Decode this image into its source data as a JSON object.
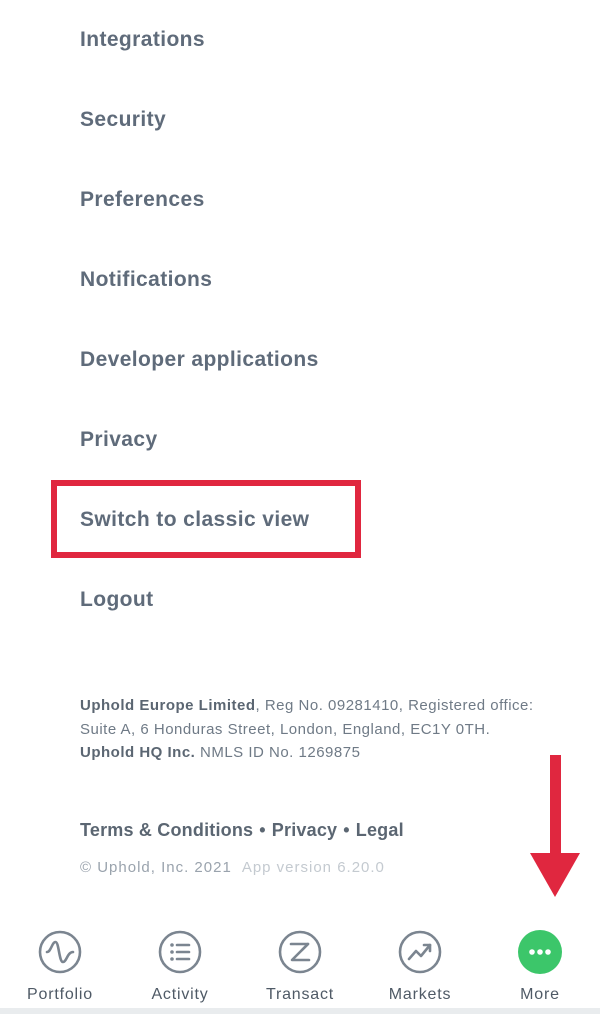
{
  "menu": {
    "items": [
      {
        "label": "Integrations"
      },
      {
        "label": "Security"
      },
      {
        "label": "Preferences"
      },
      {
        "label": "Notifications"
      },
      {
        "label": "Developer applications"
      },
      {
        "label": "Privacy"
      },
      {
        "label": "Switch to classic view"
      },
      {
        "label": "Logout"
      }
    ]
  },
  "legal": {
    "company_eu": "Uphold Europe Limited",
    "reg_text": ", Reg No. 09281410, Registered office: Suite A, 6 Honduras Street, London, England, EC1Y 0TH. ",
    "company_hq": "Uphold HQ Inc.",
    "nmls_text": " NMLS ID No. 1269875"
  },
  "footer_links": {
    "terms": "Terms & Conditions",
    "privacy": "Privacy",
    "legal": "Legal",
    "separator": "•"
  },
  "copyright": {
    "text": "© Uphold, Inc. 2021",
    "version": "App version 6.20.0"
  },
  "tabbar": {
    "tabs": [
      {
        "label": "Portfolio",
        "icon": "portfolio-icon"
      },
      {
        "label": "Activity",
        "icon": "activity-icon"
      },
      {
        "label": "Transact",
        "icon": "transact-icon"
      },
      {
        "label": "Markets",
        "icon": "markets-icon"
      },
      {
        "label": "More",
        "icon": "more-icon"
      }
    ],
    "active": "More"
  },
  "colors": {
    "text": "#5f6b7a",
    "highlight": "#e0273f",
    "accent_green": "#3cc66a",
    "icon_gray": "#7b8590"
  }
}
